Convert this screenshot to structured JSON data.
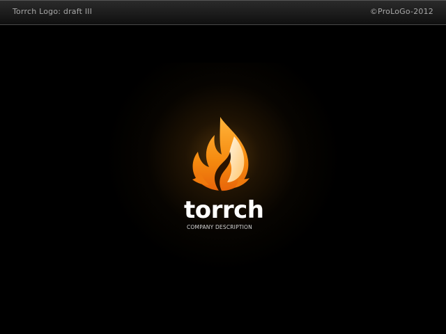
{
  "header": {
    "title": "Torrch Logo: draft III",
    "copyright": "©ProLoGo-2012"
  },
  "logo": {
    "icon": "flame-icon",
    "wordmark": "torrch",
    "registered": "®",
    "tagline": "COMPANY DESCRIPTION"
  },
  "colors": {
    "background": "#000000",
    "flame_outer": "#f28a10",
    "flame_inner": "#ffd590",
    "glow": "#8a5a14"
  }
}
